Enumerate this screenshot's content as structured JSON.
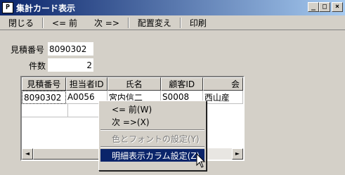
{
  "window": {
    "title": "集計カード表示"
  },
  "titlebar_buttons": {
    "minimize": "_",
    "maximize": "□",
    "close": "×"
  },
  "menu": [
    "閉じる",
    "<= 前",
    "次 =>",
    "配置変え",
    "印刷"
  ],
  "fields": {
    "estimate_no": {
      "label": "見積番号",
      "value": "8090302"
    },
    "count": {
      "label": "件数",
      "value": "2"
    }
  },
  "grid": {
    "columns": [
      "見積番号",
      "担当者ID",
      "氏名",
      "顧客ID",
      "会"
    ],
    "rows": [
      [
        "8090302",
        "A0056",
        "宮内信二",
        "S0008",
        "西山産"
      ]
    ]
  },
  "scrollbar": {
    "left_arrow": "◄",
    "right_arrow": "►"
  },
  "context_menu": {
    "items": [
      {
        "label": "<= 前(W)",
        "disabled": false,
        "selected": false
      },
      {
        "label": "次 =>(X)",
        "disabled": false,
        "selected": false
      },
      {
        "label": "色とフォントの設定(Y)",
        "disabled": true,
        "selected": false
      },
      {
        "label": "明細表示カラム設定(Z)",
        "disabled": false,
        "selected": true
      }
    ]
  }
}
